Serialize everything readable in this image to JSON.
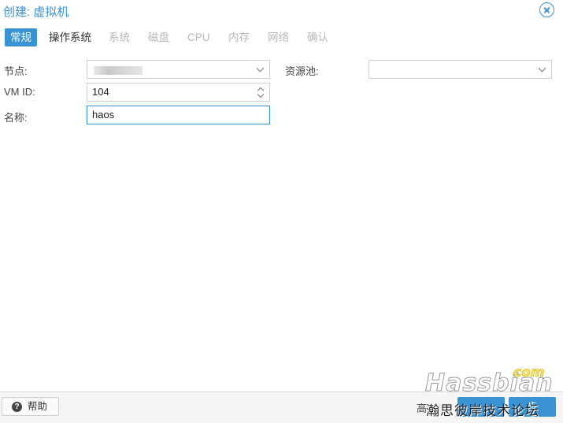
{
  "window": {
    "title": "创建: 虚拟机"
  },
  "tabs": [
    {
      "label": "常规",
      "state": "active"
    },
    {
      "label": "操作系统",
      "state": "enabled"
    },
    {
      "label": "系统",
      "state": "disabled"
    },
    {
      "label": "磁盘",
      "state": "disabled"
    },
    {
      "label": "CPU",
      "state": "disabled"
    },
    {
      "label": "内存",
      "state": "disabled"
    },
    {
      "label": "网络",
      "state": "disabled"
    },
    {
      "label": "确认",
      "state": "disabled"
    }
  ],
  "form": {
    "node": {
      "label": "节点:",
      "value": ""
    },
    "vmid": {
      "label": "VM ID:",
      "value": "104"
    },
    "name": {
      "label": "名称:",
      "value": "haos"
    },
    "pool": {
      "label": "资源池:",
      "value": ""
    }
  },
  "footer": {
    "help_label": "帮助",
    "advanced_label": "高",
    "back_label": "",
    "next_label": "步"
  },
  "watermark": {
    "main": "Hassbian",
    "com": "com",
    "sub": "瀚思彼岸技术论坛"
  },
  "colors": {
    "accent": "#3892d4"
  }
}
